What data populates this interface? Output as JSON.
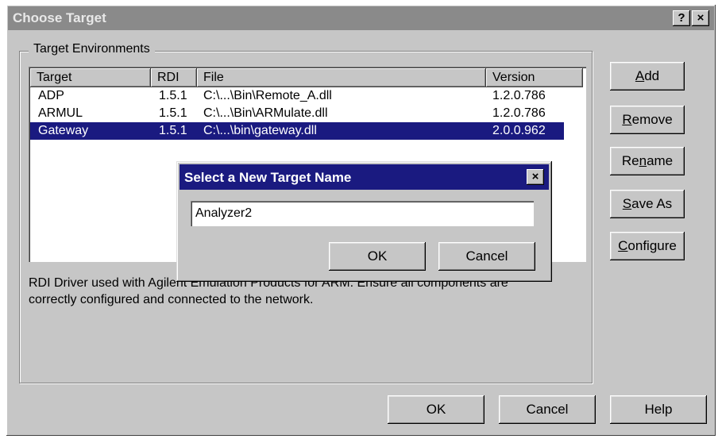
{
  "window": {
    "title": "Choose Target",
    "help_button": "?",
    "close_button": "×"
  },
  "group": {
    "label": "Target Environments"
  },
  "list": {
    "columns": [
      "Target",
      "RDI",
      "File",
      "Version"
    ],
    "rows": [
      {
        "target": "ADP",
        "rdi": "1.5.1",
        "file": "C:\\...\\Bin\\Remote_A.dll",
        "version": "1.2.0.786",
        "selected": false
      },
      {
        "target": "ARMUL",
        "rdi": "1.5.1",
        "file": "C:\\...\\Bin\\ARMulate.dll",
        "version": "1.2.0.786",
        "selected": false
      },
      {
        "target": "Gateway",
        "rdi": "1.5.1",
        "file": "C:\\...\\bin\\gateway.dll",
        "version": "2.0.0.962",
        "selected": true
      }
    ]
  },
  "description": {
    "line1": "RDI Driver used with Agilent Emulation Products for ARM. Ensure all components are",
    "line2": "correctly configured and connected to the network."
  },
  "side_buttons": {
    "add_prefix": "",
    "add_key": "A",
    "add_rest": "dd",
    "remove_prefix": "",
    "remove_key": "R",
    "remove_rest": "emove",
    "rename_prefix": "Re",
    "rename_key": "n",
    "rename_rest": "ame",
    "saveas_prefix": "",
    "saveas_key": "S",
    "saveas_rest": "ave As",
    "configure_prefix": "",
    "configure_key": "C",
    "configure_rest": "onfigure"
  },
  "bottom_buttons": {
    "ok": "OK",
    "cancel": "Cancel",
    "help": "Help"
  },
  "dialog": {
    "title": "Select a New Target Name",
    "close": "×",
    "input_value": "Analyzer2",
    "ok": "OK",
    "cancel": "Cancel"
  },
  "colors": {
    "selection": "#1a1a80",
    "face": "#c6c6c6",
    "inactive_title": "#8a8a8a"
  }
}
